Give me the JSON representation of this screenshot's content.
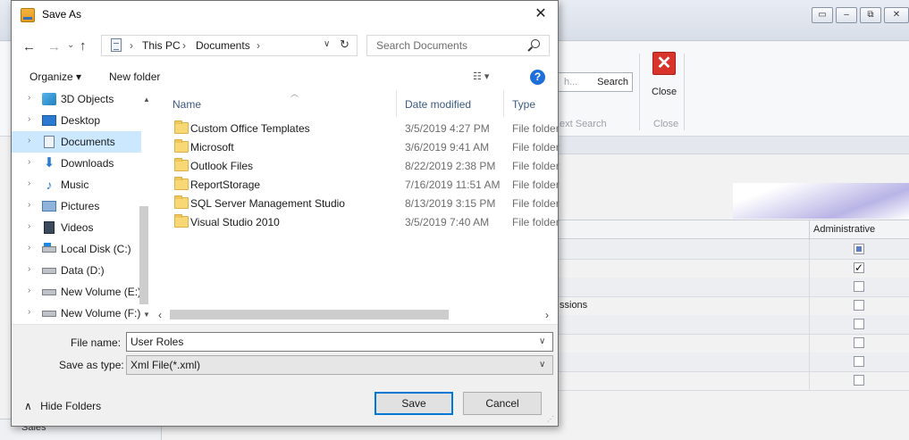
{
  "background_app": {
    "ribbon_search_button": "Search",
    "ribbon_search_ghost": "h...",
    "ribbon_group_search": "ext Search",
    "ribbon_close_label": "Close",
    "ribbon_group_close": "Close",
    "grid_column_admin": "Administrative",
    "grid_row_partial_text": "ssions",
    "left_nav_partial": "Sales",
    "admin_checks": [
      "indeterminate",
      "checked",
      "unchecked",
      "unchecked",
      "unchecked",
      "unchecked",
      "unchecked",
      "unchecked"
    ]
  },
  "dialog": {
    "title": "Save As",
    "close_glyph": "✕",
    "address": {
      "crumbs": [
        "This PC",
        "Documents"
      ],
      "separator": "›"
    },
    "search": {
      "placeholder": "Search Documents"
    },
    "toolbar": {
      "organize_label": "Organize ▾",
      "new_folder_label": "New folder",
      "help_glyph": "?"
    },
    "nav_tree": [
      {
        "label": "3D Objects",
        "icon": "cube-icon",
        "selected": false
      },
      {
        "label": "Desktop",
        "icon": "desktop-icon",
        "selected": false
      },
      {
        "label": "Documents",
        "icon": "documents-icon",
        "selected": true
      },
      {
        "label": "Downloads",
        "icon": "download-icon",
        "selected": false
      },
      {
        "label": "Music",
        "icon": "music-icon",
        "selected": false
      },
      {
        "label": "Pictures",
        "icon": "pictures-icon",
        "selected": false
      },
      {
        "label": "Videos",
        "icon": "videos-icon",
        "selected": false
      },
      {
        "label": "Local Disk (C:)",
        "icon": "disk-icon",
        "selected": false
      },
      {
        "label": "Data (D:)",
        "icon": "disk-icon",
        "selected": false
      },
      {
        "label": "New Volume (E:)",
        "icon": "disk-icon",
        "selected": false
      },
      {
        "label": "New Volume (F:)",
        "icon": "disk-icon",
        "selected": false
      }
    ],
    "columns": {
      "name": "Name",
      "date": "Date modified",
      "type": "Type"
    },
    "files": [
      {
        "name": "Custom Office Templates",
        "date": "3/5/2019 4:27 PM",
        "type": "File folder"
      },
      {
        "name": "Microsoft",
        "date": "3/6/2019 9:41 AM",
        "type": "File folder"
      },
      {
        "name": "Outlook Files",
        "date": "8/22/2019 2:38 PM",
        "type": "File folder"
      },
      {
        "name": "ReportStorage",
        "date": "7/16/2019 11:51 AM",
        "type": "File folder"
      },
      {
        "name": "SQL Server Management Studio",
        "date": "8/13/2019 3:15 PM",
        "type": "File folder"
      },
      {
        "name": "Visual Studio 2010",
        "date": "3/5/2019 7:40 AM",
        "type": "File folder"
      }
    ],
    "form": {
      "filename_label": "File name:",
      "filename_value": "User Roles",
      "savetype_label": "Save as type:",
      "savetype_value": "Xml File(*.xml)"
    },
    "footer": {
      "hide_folders_label": "Hide Folders",
      "save_label": "Save",
      "cancel_label": "Cancel"
    }
  },
  "colors": {
    "selection": "#cce8ff",
    "accent": "#0078d7",
    "help": "#1e6fd9",
    "folder": "#f8d775",
    "close_red": "#d9342b"
  }
}
